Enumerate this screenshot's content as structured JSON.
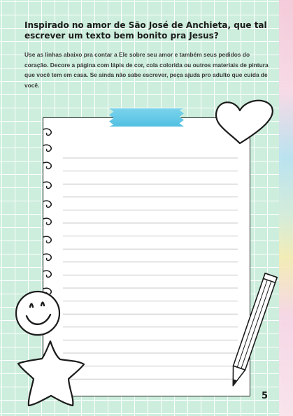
{
  "page": {
    "title": "Inspirado no amor de São José de Anchieta, que tal escrever um texto bem bonito pra Jesus?",
    "instructions": "Use as linhas abaixo pra contar a Ele sobre seu amor e também seus pedidos do coração. Decore a página com lápis de cor, cola colorida ou outros materiais de pintura que você tem em casa. Se ainda não sabe escrever, peça ajuda pro adulto que cuida de você.",
    "page_number": "5"
  },
  "colors": {
    "background": "#cdeedd",
    "grid": "#ffffff",
    "tape": "#52c0e2",
    "ink": "#1c1c1c",
    "paper": "#ffffff",
    "ruled_line": "#c8c8c8"
  },
  "decorations": [
    "heart-icon",
    "smiley-face-icon",
    "star-icon",
    "pencil-icon",
    "tape-strip",
    "spiral-rings"
  ]
}
